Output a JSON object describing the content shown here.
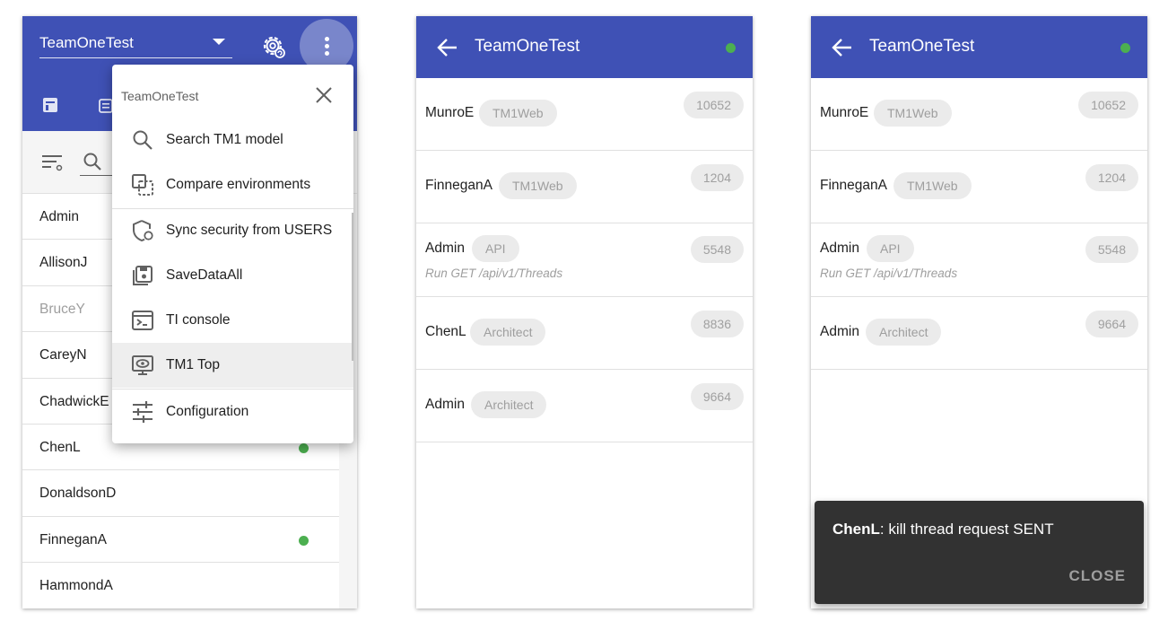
{
  "colors": {
    "primary": "#3f51b5",
    "online": "#4caf50",
    "snackbar": "#323232"
  },
  "panel1": {
    "environment": "TeamOneTest",
    "users": [
      {
        "name": "Admin",
        "online": false,
        "dim": false
      },
      {
        "name": "AllisonJ",
        "online": false,
        "dim": false
      },
      {
        "name": "BruceY",
        "online": false,
        "dim": true
      },
      {
        "name": "CareyN",
        "online": false,
        "dim": false
      },
      {
        "name": "ChadwickE",
        "online": false,
        "dim": false
      },
      {
        "name": "ChenL",
        "online": true,
        "dim": false
      },
      {
        "name": "DonaldsonD",
        "online": false,
        "dim": false
      },
      {
        "name": "FinneganA",
        "online": true,
        "dim": false
      },
      {
        "name": "HammondA",
        "online": false,
        "dim": false
      }
    ],
    "menu": {
      "title": "TeamOneTest",
      "items": [
        {
          "label": "Search TM1 model",
          "icon": "search-icon"
        },
        {
          "label": "Compare environments",
          "icon": "compare-icon"
        },
        {
          "label": "Sync security from USERS",
          "icon": "shield-sync-icon"
        },
        {
          "label": "SaveDataAll",
          "icon": "save-icon"
        },
        {
          "label": "TI console",
          "icon": "console-icon"
        },
        {
          "label": "TM1 Top",
          "icon": "monitor-eye-icon"
        },
        {
          "label": "Configuration",
          "icon": "sliders-icon"
        }
      ]
    }
  },
  "panel2": {
    "title": "TeamOneTest",
    "threads": [
      {
        "user": "MunroE",
        "context": "TM1Web",
        "id": "10652",
        "command": ""
      },
      {
        "user": "FinneganA",
        "context": "TM1Web",
        "id": "1204",
        "command": ""
      },
      {
        "user": "Admin",
        "context": "API",
        "id": "5548",
        "command": "Run GET /api/v1/Threads"
      },
      {
        "user": "ChenL",
        "context": "Architect",
        "id": "8836",
        "command": ""
      },
      {
        "user": "Admin",
        "context": "Architect",
        "id": "9664",
        "command": ""
      }
    ]
  },
  "panel3": {
    "title": "TeamOneTest",
    "threads": [
      {
        "user": "MunroE",
        "context": "TM1Web",
        "id": "10652",
        "command": ""
      },
      {
        "user": "FinneganA",
        "context": "TM1Web",
        "id": "1204",
        "command": ""
      },
      {
        "user": "Admin",
        "context": "API",
        "id": "5548",
        "command": "Run GET /api/v1/Threads"
      },
      {
        "user": "Admin",
        "context": "Architect",
        "id": "9664",
        "command": ""
      }
    ],
    "snackbar": {
      "user": "ChenL",
      "message": ": kill thread request SENT",
      "action": "CLOSE"
    }
  }
}
